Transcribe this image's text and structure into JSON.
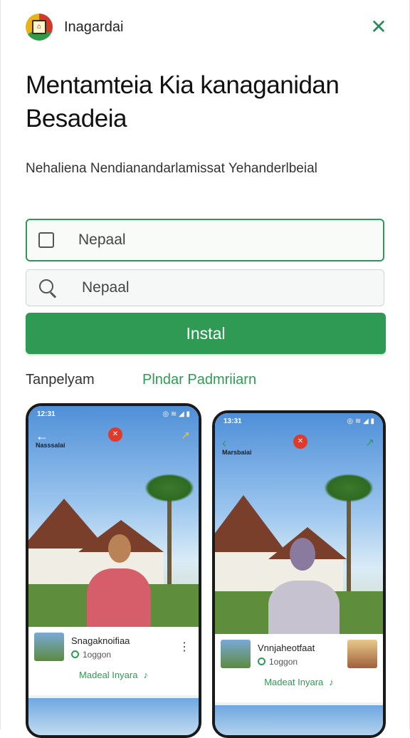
{
  "header": {
    "app_name": "Inagardai",
    "logo_glyph": "⌂",
    "close_icon": "✕"
  },
  "title": "Mentamteia Kia kanaganidan Besadeia",
  "subtitle": "Nehaliena Nendianandarlamissat Yehanderlbeial",
  "fields": [
    {
      "value": "Nepaal",
      "icon": "checkbox-icon"
    },
    {
      "value": "Nepaal",
      "icon": "search-icon"
    }
  ],
  "install_label": "Instal",
  "tabs": {
    "first": "Tanpelyam",
    "second": "Plndar Padmriiarn"
  },
  "screenshots": [
    {
      "status_time": "12:31",
      "status_icons": "◎ ≋ ◢ ▮",
      "screen_label": "Nasssalai",
      "rec_glyph": "✕",
      "card_title": "Snagaknoifiaa",
      "card_sub": "1oggon",
      "card_button": "Madeal Inyara",
      "tool_glyph": "♪"
    },
    {
      "status_time": "13:31",
      "status_icons": "◎ ≋ ◢ ▮",
      "screen_label": "Marsbaiai",
      "rec_glyph": "✕",
      "card_title": "Vnnjaheotfaat",
      "card_sub": "1oggon",
      "card_button": "Madeat Inyara",
      "tool_glyph": "♪"
    }
  ],
  "colors": {
    "accent": "#2f9a53",
    "recording": "#e03a2c",
    "text": "#1f1f1f"
  }
}
